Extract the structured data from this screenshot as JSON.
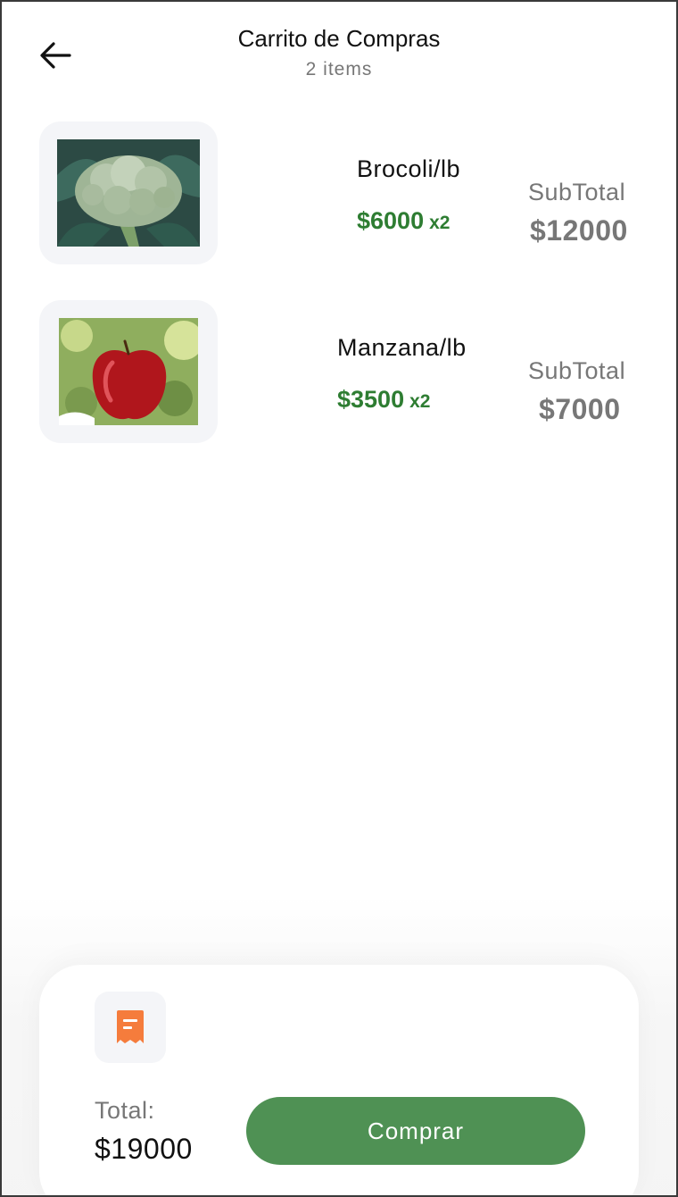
{
  "header": {
    "title": "Carrito de Compras",
    "subtitle": "2 items"
  },
  "cart": {
    "items": [
      {
        "name": "Brocoli/lb",
        "price": "$6000",
        "quantity": "x2",
        "subtotal_label": "SubTotal",
        "subtotal_value": "$12000"
      },
      {
        "name": "Manzana/lb",
        "price": "$3500",
        "quantity": "x2",
        "subtotal_label": "SubTotal",
        "subtotal_value": "$7000"
      }
    ]
  },
  "summary": {
    "total_label": "Total:",
    "total_value": "$19000",
    "buy_label": "Comprar"
  },
  "colors": {
    "price_green": "#2e7d32",
    "button_green": "#4f9154",
    "receipt_orange": "#f57c3c"
  }
}
